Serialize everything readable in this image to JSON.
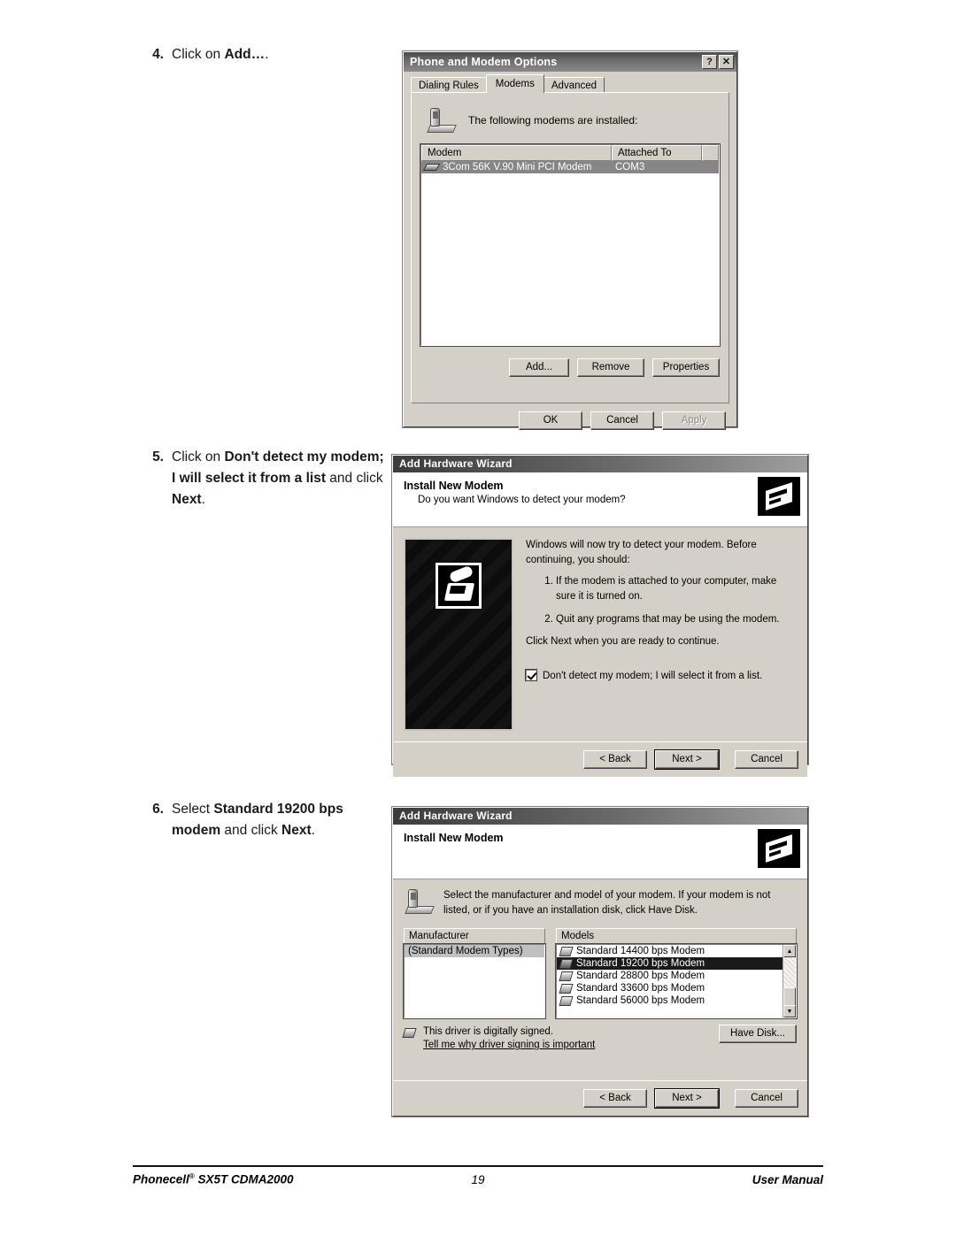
{
  "steps": [
    {
      "num": "4.",
      "html_plain": "Click on Add…."
    },
    {
      "num": "5.",
      "html_plain": "Click on Don't detect my modem; I will select it from a list and click Next."
    },
    {
      "num": "6.",
      "html_plain": "Select Standard 19200 bps modem and click Next."
    }
  ],
  "step4": {
    "num": "4.",
    "lead": "Click on ",
    "bold": "Add…",
    "tail": "."
  },
  "step5": {
    "num": "5.",
    "lead": "Click on ",
    "bold": "Don't detect my modem; I will select it from a list",
    "mid": " and click ",
    "bold2": "Next",
    "tail": "."
  },
  "step6": {
    "num": "6.",
    "lead": "Select ",
    "bold": "Standard 19200 bps modem",
    "mid": " and click ",
    "bold2": "Next",
    "tail": "."
  },
  "dialog1": {
    "title": "Phone and Modem Options",
    "help_button": "?",
    "close_button": "✕",
    "tabs": [
      {
        "label": "Dialing Rules",
        "active": false
      },
      {
        "label": "Modems",
        "active": true
      },
      {
        "label": "Advanced",
        "active": false
      }
    ],
    "caption": "The following modems are  installed:",
    "columns": [
      "Modem",
      "Attached To"
    ],
    "rows": [
      {
        "modem": "3Com 56K V.90 Mini PCI Modem",
        "attached_to": "COM3",
        "selected": true
      }
    ],
    "buttons": [
      {
        "label": "Add...",
        "enabled": true
      },
      {
        "label": "Remove",
        "enabled": true
      },
      {
        "label": "Properties",
        "enabled": true
      }
    ],
    "footer_buttons": [
      {
        "label": "OK",
        "enabled": true
      },
      {
        "label": "Cancel",
        "enabled": true
      },
      {
        "label": "Apply",
        "enabled": false
      }
    ]
  },
  "dialog2": {
    "title": "Add Hardware Wizard",
    "heading": "Install New Modem",
    "subheading": "Do you want Windows to detect your modem?",
    "intro": "Windows will now try to detect your modem.  Before continuing, you should:",
    "list": [
      "If the modem is attached to your computer, make sure it is turned on.",
      "Quit any programs that may be using the modem."
    ],
    "closing": "Click Next when you are ready to continue.",
    "checkbox": {
      "label": "Don't detect my modem; I will select it from a list.",
      "checked": true
    },
    "buttons": [
      {
        "label": "< Back",
        "default": false
      },
      {
        "label": "Next >",
        "default": true
      },
      {
        "label": "Cancel",
        "default": false
      }
    ]
  },
  "dialog3": {
    "title": "Add Hardware Wizard",
    "heading": "Install New Modem",
    "note": "Select the manufacturer and model of your modem. If your modem is not listed, or if you have an installation disk, click Have Disk.",
    "manufacturer_label": "Manufacturer",
    "models_label": "Models",
    "manufacturers": [
      {
        "label": "(Standard Modem Types)",
        "selected": true
      }
    ],
    "models": [
      {
        "label": "Standard 14400 bps Modem",
        "selected": false
      },
      {
        "label": "Standard 19200 bps Modem",
        "selected": true
      },
      {
        "label": "Standard 28800 bps Modem",
        "selected": false
      },
      {
        "label": "Standard 33600 bps Modem",
        "selected": false
      },
      {
        "label": "Standard 56000 bps Modem",
        "selected": false
      }
    ],
    "signed_text": "This driver is digitally signed.",
    "signing_link": "Tell me why driver signing is important",
    "have_disk_button": "Have Disk...",
    "buttons": [
      {
        "label": "< Back",
        "default": false
      },
      {
        "label": "Next >",
        "default": true
      },
      {
        "label": "Cancel",
        "default": false
      }
    ],
    "scroll_up": "▲",
    "scroll_down": "▼"
  },
  "footer": {
    "product": "Phonecell",
    "registered": "®",
    "model": " SX5T CDMA2000",
    "page": "19",
    "doc": "User Manual"
  }
}
